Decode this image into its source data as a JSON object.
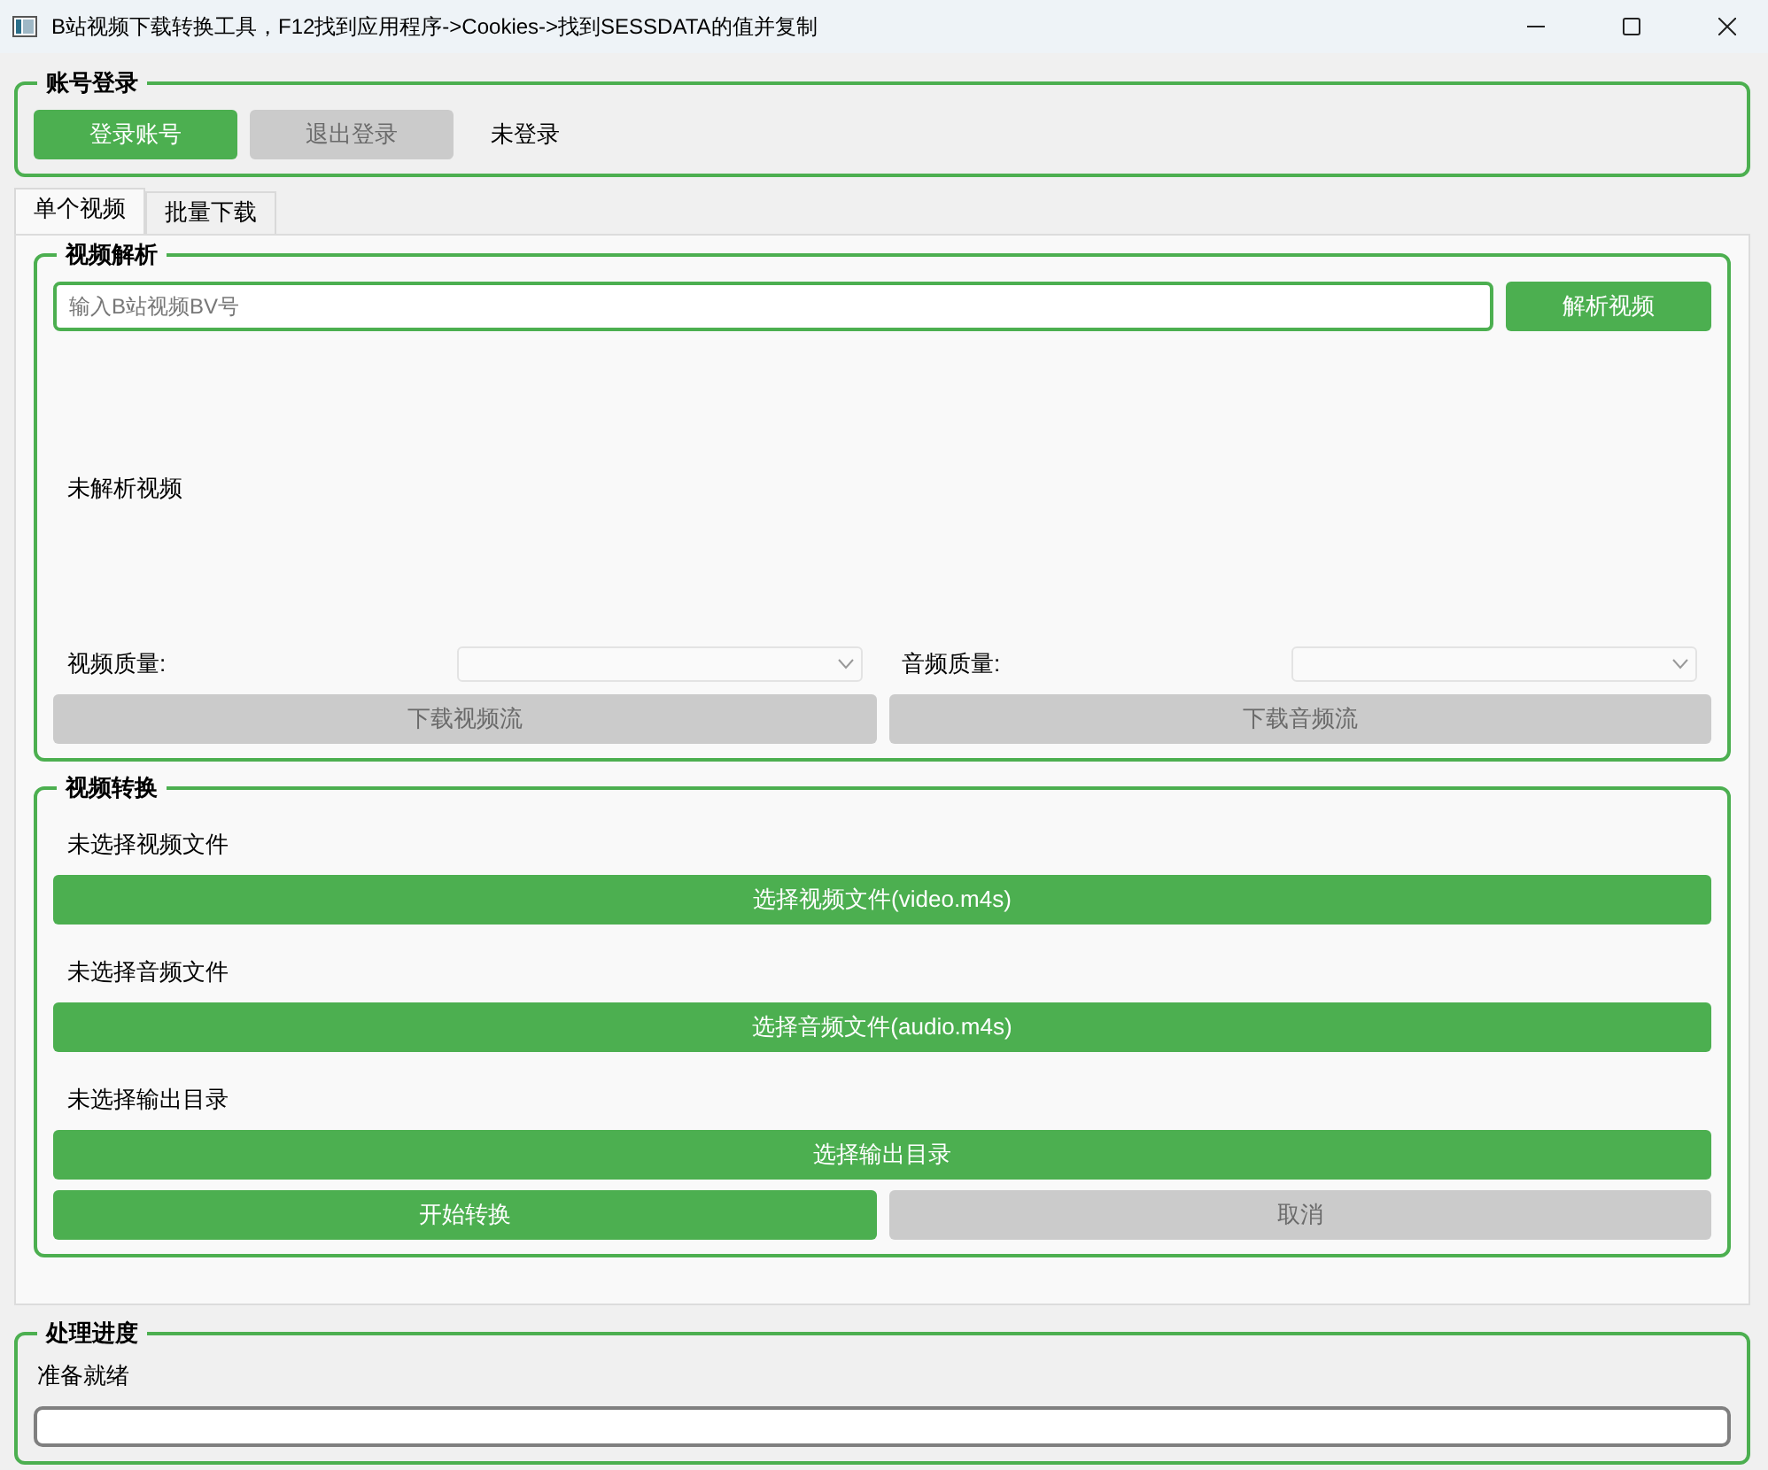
{
  "window": {
    "title": "B站视频下载转换工具，F12找到应用程序->Cookies->找到SESSDATA的值并复制"
  },
  "login": {
    "title": "账号登录",
    "buttons": [
      {
        "label": "登录账号",
        "disabled": false
      },
      {
        "label": "退出登录",
        "disabled": true
      }
    ],
    "status": "未登录"
  },
  "tabs": [
    {
      "label": "单个视频",
      "selected": true
    },
    {
      "label": "批量下载",
      "selected": false
    }
  ],
  "parse": {
    "title": "视频解析",
    "input": {
      "placeholder": "输入B站视频BV号"
    },
    "parse_button": {
      "label": "解析视频",
      "disabled": false
    },
    "info": "未解析视频",
    "quality": [
      {
        "label": "视频质量:",
        "combo_disabled": true,
        "download": {
          "label": "下载视频流",
          "disabled": true
        }
      },
      {
        "label": "音频质量:",
        "combo_disabled": true,
        "download": {
          "label": "下载音频流",
          "disabled": true
        }
      }
    ]
  },
  "convert": {
    "title": "视频转换",
    "files": [
      {
        "status": "未选择视频文件",
        "button": {
          "label": "选择视频文件(video.m4s)",
          "disabled": false
        }
      },
      {
        "status": "未选择音频文件",
        "button": {
          "label": "选择音频文件(audio.m4s)",
          "disabled": false
        }
      },
      {
        "status": "未选择输出目录",
        "button": {
          "label": "选择输出目录",
          "disabled": false
        }
      }
    ],
    "actions": [
      {
        "label": "开始转换",
        "disabled": false
      },
      {
        "label": "取消",
        "disabled": true
      }
    ]
  },
  "progress": {
    "title": "处理进度",
    "status": "准备就绪",
    "level": 0
  }
}
